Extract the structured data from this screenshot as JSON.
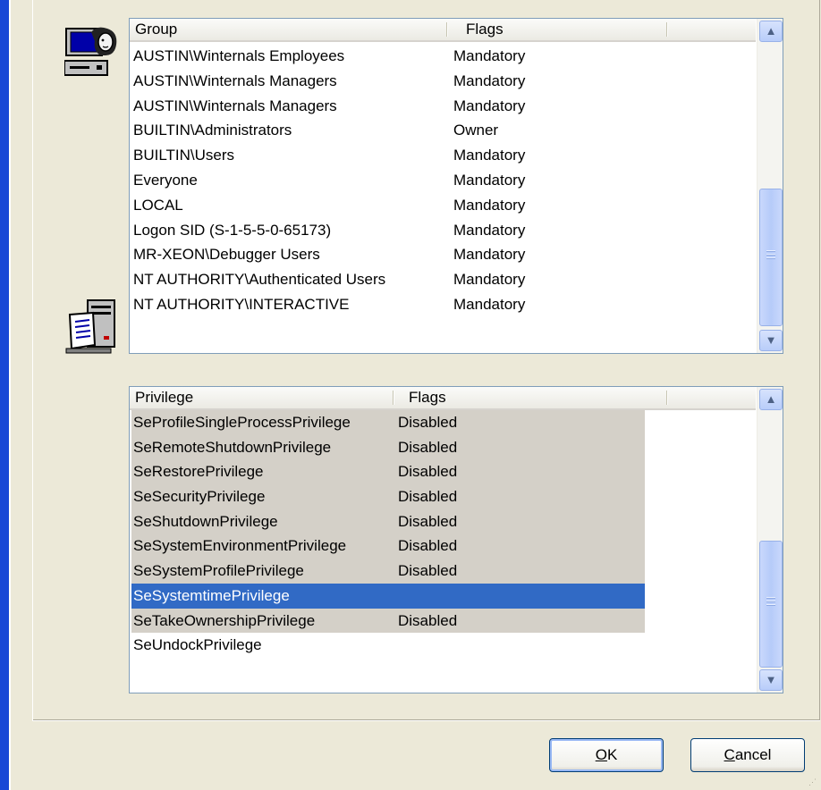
{
  "groups_list": {
    "columns": [
      "Group",
      "Flags"
    ],
    "rows": [
      {
        "group": "AUSTIN\\Winternals Employees",
        "flags": "Mandatory"
      },
      {
        "group": "AUSTIN\\Winternals Managers",
        "flags": "Mandatory"
      },
      {
        "group": "AUSTIN\\Winternals Managers",
        "flags": "Mandatory"
      },
      {
        "group": "BUILTIN\\Administrators",
        "flags": "Owner"
      },
      {
        "group": "BUILTIN\\Users",
        "flags": "Mandatory"
      },
      {
        "group": "Everyone",
        "flags": "Mandatory"
      },
      {
        "group": "LOCAL",
        "flags": "Mandatory"
      },
      {
        "group": "Logon SID (S-1-5-5-0-65173)",
        "flags": "Mandatory"
      },
      {
        "group": "MR-XEON\\Debugger Users",
        "flags": "Mandatory"
      },
      {
        "group": "NT AUTHORITY\\Authenticated Users",
        "flags": "Mandatory"
      },
      {
        "group": "NT AUTHORITY\\INTERACTIVE",
        "flags": "Mandatory"
      }
    ]
  },
  "privileges_list": {
    "columns": [
      "Privilege",
      "Flags"
    ],
    "rows": [
      {
        "privilege": "SeProfileSingleProcessPrivilege",
        "flags": "Disabled",
        "state": "disabled"
      },
      {
        "privilege": "SeRemoteShutdownPrivilege",
        "flags": "Disabled",
        "state": "disabled"
      },
      {
        "privilege": "SeRestorePrivilege",
        "flags": "Disabled",
        "state": "disabled"
      },
      {
        "privilege": "SeSecurityPrivilege",
        "flags": "Disabled",
        "state": "disabled"
      },
      {
        "privilege": "SeShutdownPrivilege",
        "flags": "Disabled",
        "state": "disabled"
      },
      {
        "privilege": "SeSystemEnvironmentPrivilege",
        "flags": "Disabled",
        "state": "disabled"
      },
      {
        "privilege": "SeSystemProfilePrivilege",
        "flags": "Disabled",
        "state": "disabled"
      },
      {
        "privilege": "SeSystemtimePrivilege",
        "flags": "",
        "state": "selected"
      },
      {
        "privilege": "SeTakeOwnershipPrivilege",
        "flags": "Disabled",
        "state": "disabled"
      },
      {
        "privilege": "SeUndockPrivilege",
        "flags": "",
        "state": "normal"
      }
    ]
  },
  "buttons": {
    "ok_access_key": "O",
    "ok_rest": "K",
    "cancel_access_key": "C",
    "cancel_rest": "ancel"
  },
  "colors": {
    "selection": "#316ac5",
    "disabled_highlight": "#d4d0c8",
    "window_frame": "#1847d6"
  },
  "icons": {
    "groups_icon": "computer-user-icon",
    "privileges_icon": "server-document-icon"
  }
}
